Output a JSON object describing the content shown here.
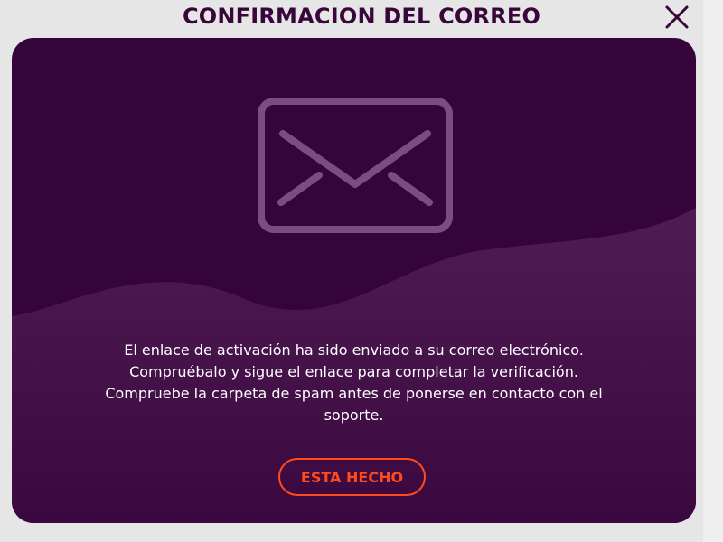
{
  "modal": {
    "title": "CONFIRMACION DEL CORREO",
    "close_icon": "close-icon"
  },
  "panel": {
    "icon": "envelope-icon",
    "message_lines": [
      "El enlace de activación ha sido enviado a su correo electrónico.",
      "Compruébalo y sigue el enlace para completar la verificación.",
      "Compruebe la carpeta de spam antes de ponerse en contacto con el",
      "soporte."
    ],
    "button_label": "ESTA HECHO"
  },
  "colors": {
    "title": "#38063b",
    "panel_bg": "#35043a",
    "wave": "#4d1a50",
    "icon_stroke": "#7b4c82",
    "accent": "#ff4a1c",
    "page_bg": "#e6e6e6"
  }
}
